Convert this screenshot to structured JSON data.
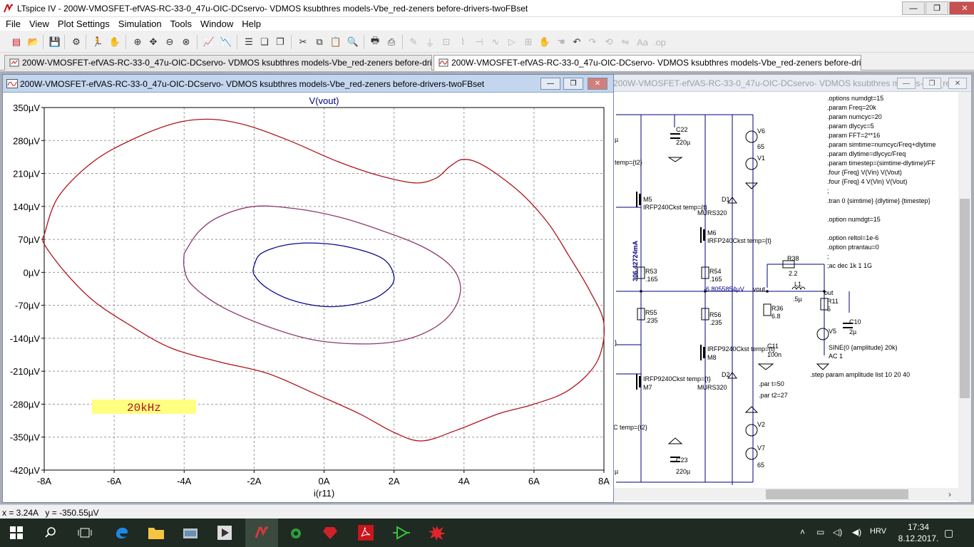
{
  "app": {
    "title": "LTspice IV - 200W-VMOSFET-efVAS-RC-33-0_47u-OIC-DCservo- VDMOS ksubthres models-Vbe_red-zeners before-drivers-twoFBset",
    "window_buttons": {
      "minimize": "—",
      "restore": "❐",
      "close": "✕"
    }
  },
  "menu": [
    "File",
    "View",
    "Plot Settings",
    "Simulation",
    "Tools",
    "Window",
    "Help"
  ],
  "tabs": [
    {
      "label": "200W-VMOSFET-efVAS-RC-33-0_47u-OIC-DCservo- VDMOS ksubthres models-Vbe_red-zeners before-drivers-twoFBset",
      "icon": "schematic-icon"
    },
    {
      "label": "200W-VMOSFET-efVAS-RC-33-0_47u-OIC-DCservo- VDMOS ksubthres models-Vbe_red-zeners before-drivers-twoFBset",
      "icon": "waveform-icon"
    }
  ],
  "schematic_window": {
    "title": "200W-VMOSFET-efVAS-RC-33-0_47u-OIC-DCservo- VDMOS ksubthres models-Vbe_red-...",
    "directives": [
      ".options numdgt=15",
      ".param Freq=20k",
      ".param numcyc=20",
      ".param dlycyc=5",
      ".param FFT=2**16",
      ".param simtime=numcyc/Freq+dlytime",
      ".param dlytime=dlycyc/Freq",
      ".param timestep=(simtime-dlytime)/FF",
      ".four {Freq} V(Vin) V(Vout)",
      ".four {Freq} 4 V(Vin) V(Vout)",
      ";",
      ".tran 0 {simtime} {dlytime} {timestep}",
      ".option numdgt=15",
      ".option reltol=1e-6",
      ".option ptrantau=0",
      ";",
      ";ac dec 1k 1 1G",
      ".step param amplitude list 10 20 40",
      ".par t=50",
      ".par t2=27"
    ],
    "labels": {
      "c22": "C22",
      "c22v": "220µ",
      "v6": "V6",
      "v6v": "65",
      "v1": "V1",
      "tempt2a": "temp={t2}",
      "mu": "µ",
      "m5": "M5",
      "m5m": "IRFP240Ckst temp={t}",
      "d1": "D1",
      "d1m": "MURS320",
      "m6": "M6",
      "m6m": "IRFP240Ckst temp={t}",
      "current": "306.42724mA",
      "r53": "R53",
      "r53v": ".165",
      "r54": "R54",
      "r54v": ".165",
      "vout_val": "-6.8055854µV",
      "vout": "vout",
      "r38": "R38",
      "r38v": "2.2",
      "l1": "L1",
      "l1v": ".5µ",
      "out": "out",
      "r11": "R11",
      "r11v": "5",
      "r55": "R55",
      "r55v": ".235",
      "r56": "R56",
      "r56v": ".235",
      "r36": "R36",
      "r36v": "6.8",
      "c10": "C10",
      "c10v": "2µ",
      "v5": "V5",
      "sine": "SINE(0 {amplitude} 20k)",
      "ac1": "AC 1",
      "m8m": "IRFP9240Ckst temp={t}",
      "m8": "M8",
      "c11": "C11",
      "c11v": "100n",
      "m7m": "IRFP9240Ckst temp={t}",
      "m7": "M7",
      "d2": "D2",
      "d2m": "MURS320",
      "tempt2b": "C temp={t2}",
      "v2": "V2",
      "v7": "V7",
      "v7v": "65",
      "c23": "C23",
      "c23v": "220µ",
      "mu2": "µ",
      "brace": "}"
    }
  },
  "plot_window": {
    "title": "200W-VMOSFET-efVAS-RC-33-0_47u-OIC-DCservo- VDMOS ksubthres models-Vbe_red-zeners before-drivers-twoFBset",
    "annotation": "20kHz"
  },
  "chart_data": {
    "type": "line",
    "title": "V(vout)",
    "xlabel": "i(r11)",
    "ylabel": "",
    "xlim": [
      -8,
      8
    ],
    "ylim": [
      -420,
      350
    ],
    "x_unit": "A",
    "y_unit": "µV",
    "x_ticks": [
      "-8A",
      "-6A",
      "-4A",
      "-2A",
      "0A",
      "2A",
      "4A",
      "6A",
      "8A"
    ],
    "y_ticks": [
      "350µV",
      "280µV",
      "210µV",
      "140µV",
      "70µV",
      "0µV",
      "-70µV",
      "-140µV",
      "-210µV",
      "-280µV",
      "-350µV",
      "-420µV"
    ],
    "grid": true,
    "colors": {
      "outer": "#b0141e",
      "middle": "#8c3a6e",
      "inner": "#0a0a8c",
      "grid": "#9a9a9a",
      "title": "#00008b"
    },
    "series": [
      {
        "points": [
          [
            -8,
            80
          ],
          [
            -7.6,
            160
          ],
          [
            -6.6,
            235
          ],
          [
            -5.4,
            285
          ],
          [
            -4.2,
            318
          ],
          [
            -3.2,
            325
          ],
          [
            -2.2,
            312
          ],
          [
            -1,
            280
          ],
          [
            0.4,
            235
          ],
          [
            1.6,
            205
          ],
          [
            2.6,
            190
          ],
          [
            3.2,
            200
          ],
          [
            3.6,
            225
          ],
          [
            4,
            240
          ],
          [
            4.6,
            225
          ],
          [
            5.6,
            170
          ],
          [
            6.4,
            105
          ],
          [
            7,
            35
          ],
          [
            7.6,
            -40
          ],
          [
            8,
            -110
          ],
          [
            7.8,
            -190
          ],
          [
            7,
            -250
          ],
          [
            6,
            -280
          ],
          [
            5,
            -300
          ],
          [
            3.8,
            -335
          ],
          [
            2.8,
            -358
          ],
          [
            2,
            -340
          ],
          [
            1,
            -300
          ],
          [
            -0.2,
            -260
          ],
          [
            -1.6,
            -215
          ],
          [
            -3,
            -190
          ],
          [
            -4.4,
            -160
          ],
          [
            -5.6,
            -110
          ],
          [
            -6.6,
            -60
          ],
          [
            -7.4,
            0
          ],
          [
            -8,
            60
          ],
          [
            -8,
            80
          ]
        ]
      },
      {
        "points": [
          [
            -4,
            40
          ],
          [
            -3.6,
            85
          ],
          [
            -3,
            118
          ],
          [
            -2,
            140
          ],
          [
            -0.8,
            135
          ],
          [
            0.4,
            118
          ],
          [
            1.6,
            90
          ],
          [
            2.8,
            55
          ],
          [
            3.6,
            15
          ],
          [
            3.9,
            -30
          ],
          [
            3.7,
            -80
          ],
          [
            3.1,
            -120
          ],
          [
            2.2,
            -145
          ],
          [
            1,
            -152
          ],
          [
            -0.4,
            -142
          ],
          [
            -1.8,
            -110
          ],
          [
            -3,
            -70
          ],
          [
            -3.8,
            -25
          ],
          [
            -4,
            10
          ],
          [
            -4,
            40
          ]
        ]
      },
      {
        "points": [
          [
            -2,
            15
          ],
          [
            -1.8,
            40
          ],
          [
            -1.1,
            58
          ],
          [
            -0.2,
            62
          ],
          [
            0.8,
            52
          ],
          [
            1.7,
            28
          ],
          [
            2,
            -10
          ],
          [
            1.8,
            -38
          ],
          [
            1.2,
            -62
          ],
          [
            0.2,
            -73
          ],
          [
            -0.8,
            -62
          ],
          [
            -1.6,
            -35
          ],
          [
            -2,
            -5
          ],
          [
            -2,
            15
          ]
        ]
      }
    ]
  },
  "statusbar": {
    "text": "x = 3.24A   y = -350.55µV"
  },
  "taskbar": {
    "lang": "HRV",
    "time": "17:34",
    "date": "8.12.2017."
  }
}
